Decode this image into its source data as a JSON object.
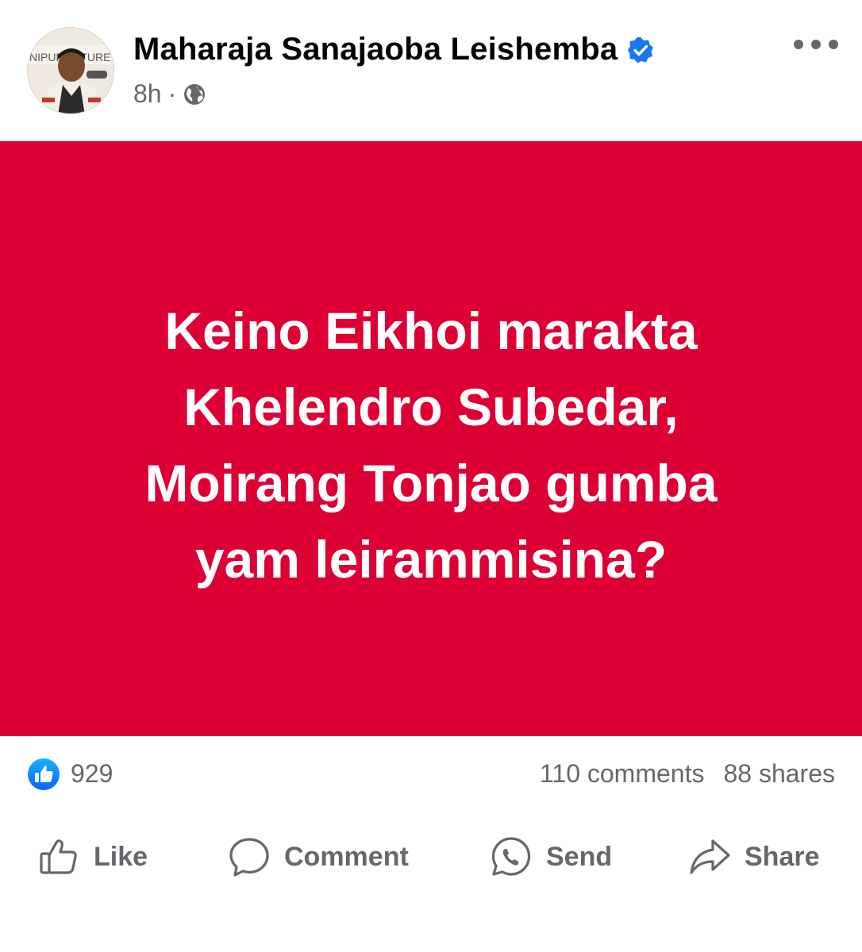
{
  "post": {
    "author": {
      "name": "Maharaja Sanajaoba Leishemba",
      "verified": true,
      "avatar_banner_text": "NIPUR   ULTURE"
    },
    "time": "8h",
    "separator": "·",
    "audience_icon": "globe-icon",
    "menu_icon": "more-options-icon",
    "content": {
      "background_color": "#dc0035",
      "lines": [
        "Keino Eikhoi marakta",
        "Khelendro Subedar,",
        "Moirang Tonjao gumba",
        "yam leirammisina?"
      ]
    },
    "stats": {
      "reactions": "929",
      "comments": "110 comments",
      "shares": "88 shares"
    },
    "actions": {
      "like": "Like",
      "comment": "Comment",
      "send": "Send",
      "share": "Share"
    },
    "colors": {
      "accent_blue": "#1877f2",
      "secondary_text": "#65676b"
    }
  }
}
